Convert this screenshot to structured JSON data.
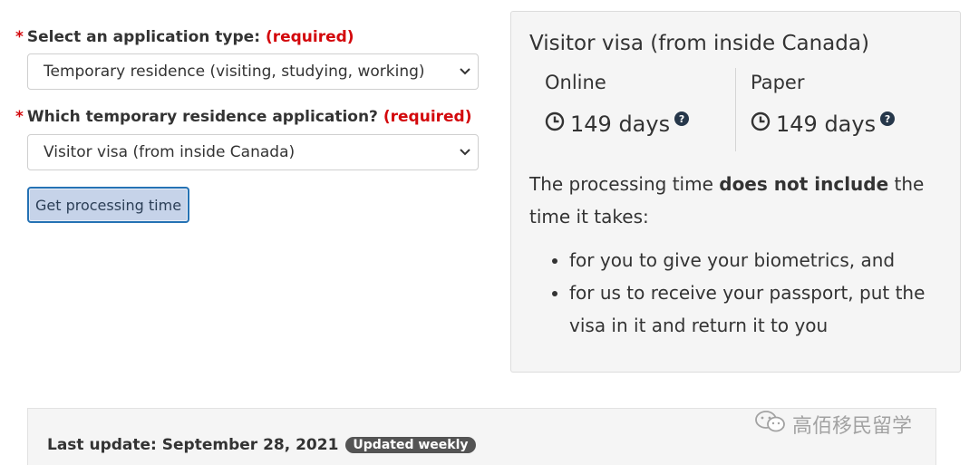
{
  "form": {
    "app_type": {
      "star": "*",
      "label": "Select an application type:",
      "required": "(required)",
      "value": "Temporary residence (visiting, studying, working)"
    },
    "tr_app": {
      "star": "*",
      "label": "Which temporary residence application?",
      "required": "(required)",
      "value": "Visitor visa (from inside Canada)"
    },
    "submit_label": "Get processing time"
  },
  "result": {
    "title": "Visitor visa (from inside Canada)",
    "online": {
      "label": "Online",
      "days": "149 days"
    },
    "paper": {
      "label": "Paper",
      "days": "149 days"
    },
    "note_pre": "The processing time ",
    "note_bold": "does not include",
    "note_post": " the time it takes:",
    "bullets": [
      "for you to give your biometrics, and",
      "for us to receive your passport, put the visa in it and return it to you"
    ]
  },
  "footer": {
    "last_update": "Last update: September 28, 2021",
    "badge": "Updated weekly"
  },
  "watermark": "高佰移民留学",
  "icons": {
    "clock": "clock-icon",
    "help": "question-circle-icon",
    "chevron": "chevron-down-icon"
  },
  "colors": {
    "required": "#d3080c",
    "button_border": "#2572b4",
    "button_bg": "#c6d3e9",
    "panel_bg": "#f5f5f5",
    "badge_bg": "#545454",
    "help_icon": "#26374a"
  }
}
